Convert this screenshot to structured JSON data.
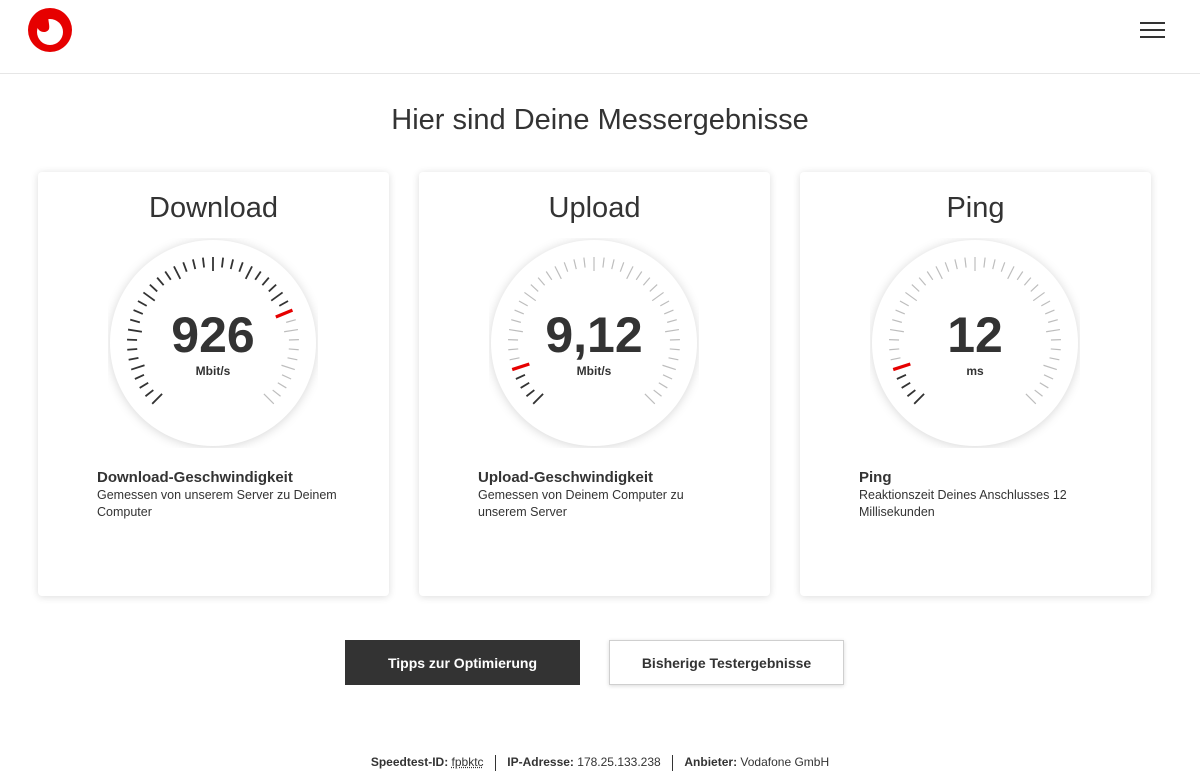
{
  "header": {
    "logo_icon": "vodafone-logo-icon",
    "menu_icon": "hamburger-menu-icon",
    "brand_color": "#e60000"
  },
  "page_title": "Hier sind Deine Messergebnisse",
  "cards": [
    {
      "title": "Download",
      "value": "926",
      "unit": "Mbit/s",
      "heading": "Download-Geschwindigkeit",
      "description": "Gemessen von unserem Server zu Deinem Computer",
      "gauge_fraction": 0.76
    },
    {
      "title": "Upload",
      "value": "9,12",
      "unit": "Mbit/s",
      "heading": "Upload-Geschwindigkeit",
      "description": "Gemessen von Deinem Computer zu unserem Server",
      "gauge_fraction": 0.1
    },
    {
      "title": "Ping",
      "value": "12",
      "unit": "ms",
      "heading": "Ping",
      "description": "Reaktionszeit Deines Anschlusses 12 Millisekunden",
      "gauge_fraction": 0.1
    }
  ],
  "buttons": {
    "tips": "Tipps zur Optimierung",
    "history": "Bisherige Testergebnisse"
  },
  "footer": {
    "speedtest_id_label": "Speedtest-ID:",
    "speedtest_id_value": "fpbktc",
    "ip_label": "IP-Adresse:",
    "ip_value": "178.25.133.238",
    "provider_label": "Anbieter:",
    "provider_value": "Vodafone GmbH"
  }
}
